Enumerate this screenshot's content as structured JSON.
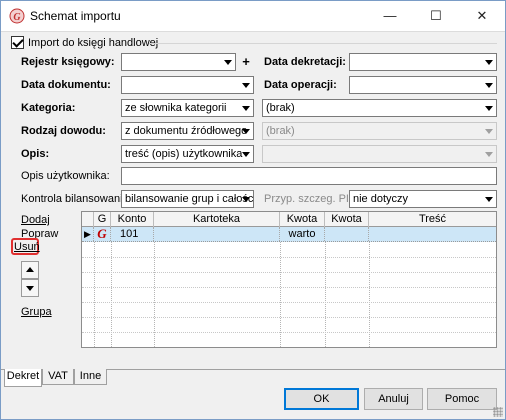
{
  "window": {
    "title": "Schemat importu",
    "controls": {
      "minimize": "—",
      "maximize": "☐",
      "close": "✕"
    }
  },
  "import": {
    "checkbox_label": "Import do księgi handlowej",
    "checked": true
  },
  "form": {
    "rejestr_label": "Rejestr księgowy:",
    "rejestr_value": "",
    "plus_label": "+",
    "data_dekretacji_label": "Data dekretacji:",
    "data_dekretacji_value": "",
    "data_dokumentu_label": "Data dokumentu:",
    "data_dokumentu_value": "",
    "data_operacji_label": "Data operacji:",
    "data_operacji_value": "",
    "kategoria_label": "Kategoria:",
    "kategoria_value": "ze słownika kategorii",
    "kategoria_value2": "(brak)",
    "rodzaj_label": "Rodzaj dowodu:",
    "rodzaj_value": "z dokumentu źródłowego",
    "rodzaj_value2": "(brak)",
    "opis_label": "Opis:",
    "opis_value": "treść (opis) użytkownika",
    "opis_value2": "",
    "opis_uzytkownika_label": "Opis użytkownika:",
    "opis_uzytkownika_value": "",
    "kontrola_label": "Kontrola bilansowania:",
    "kontrola_value": "bilansowanie grup i całości c",
    "pit_label": "Przyp. szczeg. PIT:",
    "pit_value": "nie dotyczy"
  },
  "side": {
    "dodaj": "Dodaj",
    "popraw": "Popraw",
    "usun": "Usuń",
    "grupa": "Grupa"
  },
  "grid": {
    "columns": [
      "G",
      "Konto",
      "Kartoteka",
      "Kwota",
      "Kwota",
      "Treść"
    ],
    "rows": [
      {
        "indicator": "▶",
        "g": "G",
        "konto": "101",
        "kartoteka": "",
        "kwota1": "warto",
        "kwota2": "",
        "tresc": ""
      }
    ]
  },
  "tabs": [
    "Dekret",
    "VAT",
    "Inne"
  ],
  "buttons": {
    "ok": "OK",
    "anuluj": "Anuluj",
    "pomoc": "Pomoc"
  },
  "colors": {
    "selection": "#cde6f7",
    "highlight": "#e03030",
    "accent": "#0078d7"
  }
}
